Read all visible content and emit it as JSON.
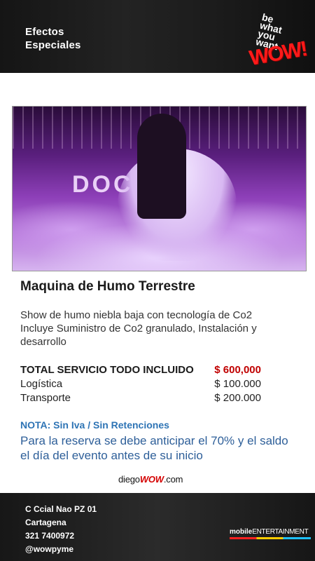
{
  "header": {
    "title_line1": "Efectos",
    "title_line2": "Especiales",
    "logo": {
      "line1": "be",
      "line2": "what",
      "line3": "you",
      "line4": "want",
      "wow": "WOW!"
    }
  },
  "product": {
    "title": "Maquina de Humo Terrestre",
    "desc_line1": "Show de humo niebla baja con tecnología de Co2",
    "desc_line2": "Incluye Suministro de Co2  granulado,  Instalación y",
    "desc_line3": "desarrollo"
  },
  "pricing": [
    {
      "label": "TOTAL SERVICIO TODO INCLUIDO",
      "value": "$ 600,000"
    },
    {
      "label": "Logística",
      "value": "$ 100.000"
    },
    {
      "label": "Transporte",
      "value": "$ 200.000"
    }
  ],
  "notes": {
    "nota": "NOTA: Sin Iva / Sin Retenciones",
    "reserva_line1": "Para la reserva se debe anticipar el 70% y el saldo",
    "reserva_line2": "el día del evento antes de su inicio"
  },
  "brand": {
    "prefix": "diego",
    "wow": "WOW",
    "suffix": ".com"
  },
  "footer": {
    "address": "C Ccial Nao PZ 01",
    "city": "Cartagena",
    "phone": "321 7400972",
    "handle": "@wowpyme",
    "sponsor_bold": "mobile",
    "sponsor_rest": "ENTERTAINMENT"
  },
  "photo": {
    "overlay_letters": "DOCE"
  },
  "colors": {
    "total_value": "#c00000",
    "nota": "#2e74b5",
    "reserva": "#2e5f99",
    "wow": "#ff1a1a"
  }
}
